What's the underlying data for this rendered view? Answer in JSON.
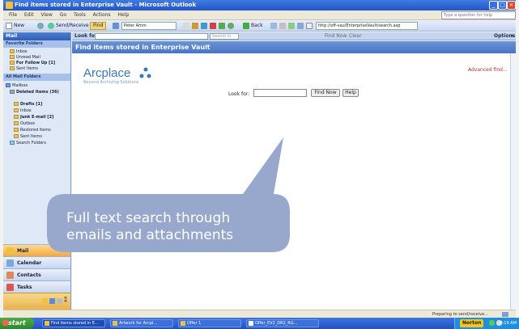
{
  "window": {
    "title": "Find items stored in Enterprise Vault - Microsoft Outlook",
    "controls": [
      "_",
      "□",
      "×"
    ]
  },
  "menu": {
    "items": [
      "File",
      "Edit",
      "View",
      "Go",
      "Tools",
      "Actions",
      "Help"
    ],
    "help_box": "Type a question for help"
  },
  "toolbar": {
    "new_label": "New",
    "send_receive_label": "Send/Receive",
    "find_label": "Find",
    "contact_value": "Peter Amm",
    "back_label": "Back",
    "address_value": "http://off-vau/EnterpriseVault/search.asp"
  },
  "left_pane": {
    "header": "Mail",
    "favorites_header": "Favorite Folders",
    "favorites": [
      {
        "name": "Inbox",
        "bold": false
      },
      {
        "name": "Unread Mail",
        "bold": false
      },
      {
        "name": "For Follow Up [1]",
        "bold": true
      },
      {
        "name": "Sent Items",
        "bold": false
      }
    ],
    "all_folders_header": "All Mail Folders",
    "folders": [
      {
        "name": "Mailbox",
        "bold": false
      },
      {
        "name": "Deleted Items (36)",
        "bold": true
      },
      {
        "name": "Drafts [1]",
        "bold": true
      },
      {
        "name": "Inbox",
        "bold": false
      },
      {
        "name": "Junk E-mail [2]",
        "bold": true
      },
      {
        "name": "Outbox",
        "bold": false
      },
      {
        "name": "Restored Items",
        "bold": false
      },
      {
        "name": "Sent Items",
        "bold": false
      },
      {
        "name": "Search Folders",
        "bold": false
      }
    ],
    "nav_buttons": [
      "Mail",
      "Calendar",
      "Contacts",
      "Tasks"
    ]
  },
  "find_bar": {
    "look_for_label": "Look for:",
    "search_in_value": "Search In",
    "find_now_label": "Find Now",
    "clear_label": "Clear",
    "options_label": "Options"
  },
  "content": {
    "header": "Find items stored in Enterprise Vault",
    "brand_name": "Arcplace",
    "brand_tagline": "Beyond Archiving Solutions",
    "advanced_find": "Advanced find...",
    "look_for_label": "Look for:",
    "look_for_value": "",
    "find_now_button": "Find Now",
    "help_button": "Help"
  },
  "status_bar": {
    "left": "",
    "right": "Preparing to send/receive..."
  },
  "taskbar": {
    "start_label": "start",
    "tasks": [
      "Find items stored in E...",
      "Artwork for Arcpl...",
      "Offer 1",
      "Offer_EV2_DR2_RG..."
    ],
    "norton_label": "Norton",
    "clock": "9:19 AM"
  },
  "callout": {
    "lines": [
      "Full text search through",
      "emails and attachments"
    ],
    "fill": "#97a8cc"
  },
  "colors": {
    "title_bar": "#2a5fd0",
    "accent": "#4a74c4",
    "brand": "#3b78b5",
    "taskbar": "#2352c2",
    "start": "#2d8a2a"
  }
}
